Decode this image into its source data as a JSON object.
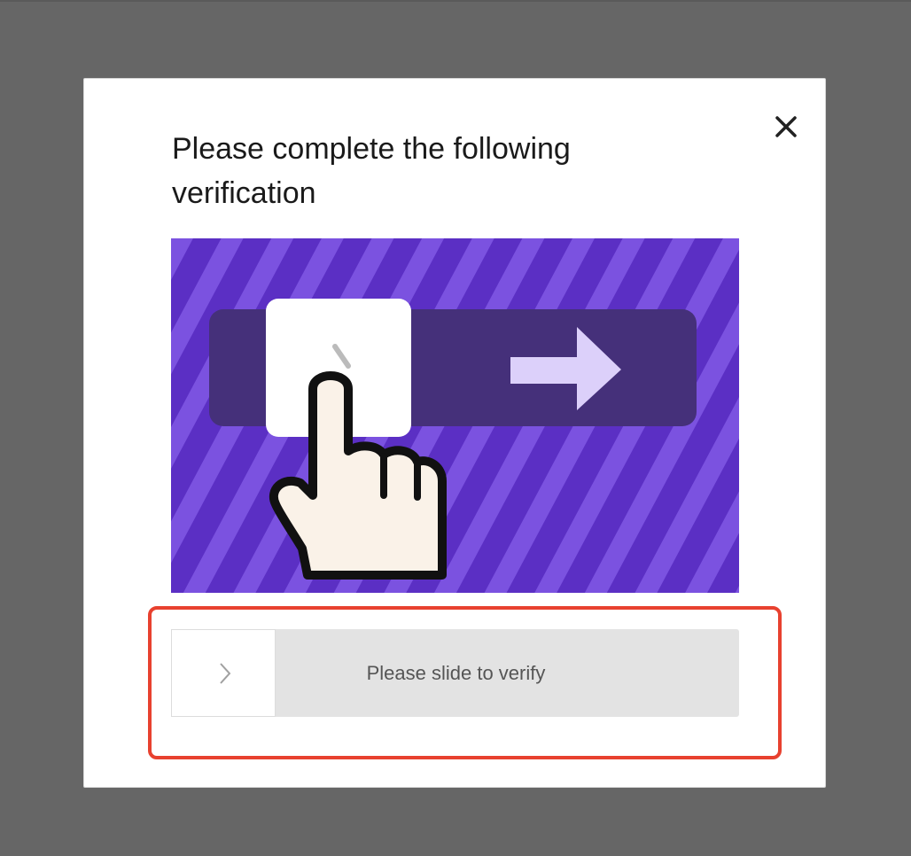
{
  "dialog": {
    "title": "Please complete the following verification",
    "close_icon": "close-icon"
  },
  "illustration": {
    "icon": "slide-to-verify-illustration",
    "background_color": "#5b2fc4",
    "stripe_color": "#7b52e0",
    "track_color": "#45307a",
    "arrow_color": "#dcd0fa"
  },
  "slider": {
    "label": "Please slide to verify",
    "handle_icon": "chevron-right-icon",
    "track_color": "#e3e3e3"
  },
  "highlight": {
    "color": "#e8412f"
  }
}
